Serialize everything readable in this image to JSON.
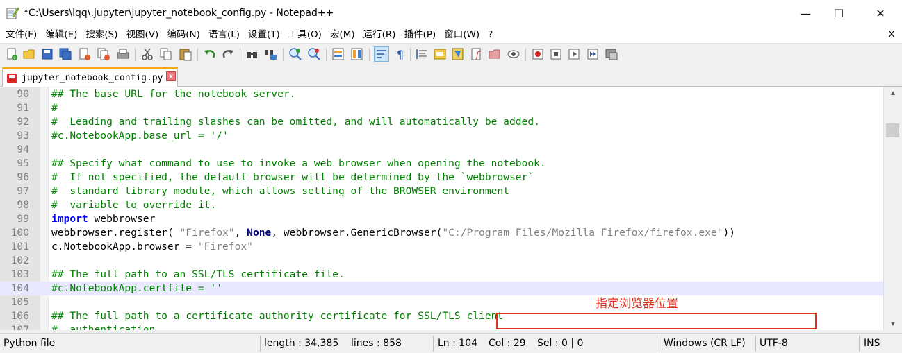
{
  "window": {
    "title": "*C:\\Users\\lqq\\.jupyter\\jupyter_notebook_config.py - Notepad++",
    "controls": {
      "minimize": "—",
      "maximize": "☐",
      "close": "✕"
    }
  },
  "menu": {
    "items": [
      "文件(F)",
      "编辑(E)",
      "搜索(S)",
      "视图(V)",
      "编码(N)",
      "语言(L)",
      "设置(T)",
      "工具(O)",
      "宏(M)",
      "运行(R)",
      "插件(P)",
      "窗口(W)",
      "?"
    ],
    "close_x": "X"
  },
  "toolbar": {
    "buttons": [
      "new-file",
      "open-file",
      "save",
      "save-all",
      "close",
      "close-all",
      "print",
      "cut",
      "copy",
      "paste",
      "undo",
      "redo",
      "find",
      "replace",
      "zoom-in",
      "zoom-out",
      "sync-vertical",
      "sync-horizontal",
      "word-wrap",
      "show-all-chars",
      "indent-guide",
      "user-defined-language",
      "document-map",
      "function-list",
      "folder-as-workspace",
      "monitoring",
      "record-macro",
      "stop-recording",
      "playback-macro",
      "run-macro-multiple",
      "save-macro"
    ]
  },
  "tab": {
    "label": "jupyter_notebook_config.py",
    "close": "x"
  },
  "editor": {
    "current_line": 104,
    "lines": [
      {
        "num": "90",
        "parts": [
          [
            "cmt",
            "## The base URL for the notebook server."
          ]
        ]
      },
      {
        "num": "91",
        "parts": [
          [
            "cmt",
            "#"
          ]
        ]
      },
      {
        "num": "92",
        "parts": [
          [
            "cmt",
            "#  Leading and trailing slashes can be omitted, and will automatically be added."
          ]
        ]
      },
      {
        "num": "93",
        "parts": [
          [
            "cmt",
            "#c.NotebookApp.base_url = '/'"
          ]
        ]
      },
      {
        "num": "94",
        "parts": []
      },
      {
        "num": "95",
        "parts": [
          [
            "cmt",
            "## Specify what command to use to invoke a web browser when opening the notebook."
          ]
        ]
      },
      {
        "num": "96",
        "parts": [
          [
            "cmt",
            "#  If not specified, the default browser will be determined by the `webbrowser`"
          ]
        ]
      },
      {
        "num": "97",
        "parts": [
          [
            "cmt",
            "#  standard library module, which allows setting of the BROWSER environment"
          ]
        ]
      },
      {
        "num": "98",
        "parts": [
          [
            "cmt",
            "#  variable to override it."
          ]
        ]
      },
      {
        "num": "99",
        "parts": [
          [
            "kw",
            "import"
          ],
          [
            "def",
            " webbrowser"
          ]
        ]
      },
      {
        "num": "100",
        "parts": [
          [
            "def",
            "webbrowser.register( "
          ],
          [
            "str",
            "\"Firefox\""
          ],
          [
            "def",
            ", "
          ],
          [
            "op",
            "None"
          ],
          [
            "def",
            ", webbrowser.GenericBrowser("
          ],
          [
            "str",
            "\"C:/Program Files/Mozilla Firefox/firefox.exe\""
          ],
          [
            "def",
            "))"
          ]
        ]
      },
      {
        "num": "101",
        "parts": [
          [
            "def",
            "c.NotebookApp.browser = "
          ],
          [
            "str",
            "\"Firefox\""
          ]
        ]
      },
      {
        "num": "102",
        "parts": []
      },
      {
        "num": "103",
        "parts": [
          [
            "cmt",
            "## The full path to an SSL/TLS certificate file."
          ]
        ]
      },
      {
        "num": "104",
        "parts": [
          [
            "cmt",
            "#c.NotebookApp.certfile = ''"
          ]
        ]
      },
      {
        "num": "105",
        "parts": []
      },
      {
        "num": "106",
        "parts": [
          [
            "cmt",
            "## The full path to a certificate authority certificate for SSL/TLS client"
          ]
        ]
      },
      {
        "num": "107",
        "parts": [
          [
            "cmt",
            "#  authentication."
          ]
        ]
      }
    ],
    "annotation": "指定浏览器位置"
  },
  "colors": {
    "comment": "#008000",
    "keyword": "#0000ff",
    "string": "#808080",
    "annotation": "#e03020",
    "current_line": "#e8e8ff"
  },
  "statusbar": {
    "file_type": "Python file",
    "length": "length : 34,385",
    "lines": "lines : 858",
    "ln": "Ln : 104",
    "col": "Col : 29",
    "sel": "Sel : 0 | 0",
    "eol": "Windows (CR LF)",
    "encoding": "UTF-8",
    "mode": "INS"
  }
}
